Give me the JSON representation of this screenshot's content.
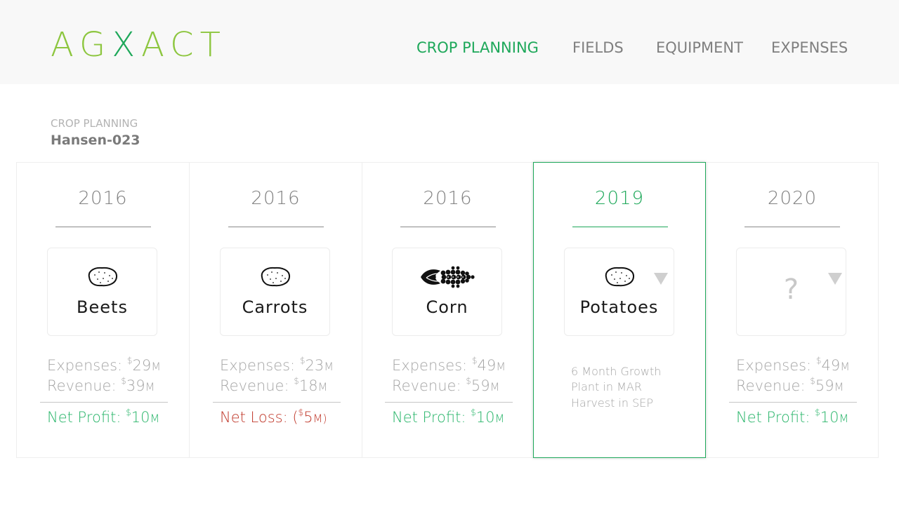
{
  "header": {
    "logo": {
      "part1": "AG",
      "part2": "X",
      "part3": "ACT"
    },
    "nav": [
      {
        "label": "CROP PLANNING",
        "active": true
      },
      {
        "label": "FIELDS",
        "active": false
      },
      {
        "label": "EQUIPMENT",
        "active": false
      },
      {
        "label": "EXPENSES",
        "active": false
      }
    ]
  },
  "page": {
    "breadcrumb": "CROP PLANNING",
    "plan_name": "Hansen-023"
  },
  "columns": [
    {
      "year": "2016",
      "crop": "Beets",
      "icon": "potato-icon",
      "expenses_label": "Expenses: ",
      "expenses_currency": "$",
      "expenses_value": "29",
      "expenses_unit": "M",
      "revenue_label": "Revenue: ",
      "revenue_currency": "$",
      "revenue_value": "39",
      "revenue_unit": "M",
      "net_label": "Net Profit: ",
      "net_currency": "$",
      "net_value": "10",
      "net_unit": "M"
    },
    {
      "year": "2016",
      "crop": "Carrots",
      "icon": "potato-icon",
      "expenses_label": "Expenses: ",
      "expenses_currency": "$",
      "expenses_value": "23",
      "expenses_unit": "M",
      "revenue_label": "Revenue: ",
      "revenue_currency": "$",
      "revenue_value": "18",
      "revenue_unit": "M",
      "net_label": "Net Loss: (",
      "net_currency": "$",
      "net_value": "5",
      "net_unit": "M)"
    },
    {
      "year": "2016",
      "crop": "Corn",
      "icon": "corn-icon",
      "expenses_label": "Expenses: ",
      "expenses_currency": "$",
      "expenses_value": "49",
      "expenses_unit": "M",
      "revenue_label": "Revenue: ",
      "revenue_currency": "$",
      "revenue_value": "59",
      "revenue_unit": "M",
      "net_label": "Net Profit: ",
      "net_currency": "$",
      "net_value": "10",
      "net_unit": "M"
    },
    {
      "year": "2019",
      "crop": "Potatoes",
      "icon": "potato-icon",
      "info": [
        "6 Month Growth",
        "Plant in MAR",
        "Harvest in SEP"
      ]
    },
    {
      "year": "2020",
      "crop": "?",
      "expenses_label": "Expenses: ",
      "expenses_currency": "$",
      "expenses_value": "49",
      "expenses_unit": "M",
      "revenue_label": "Revenue: ",
      "revenue_currency": "$",
      "revenue_value": "59",
      "revenue_unit": "M",
      "net_label": "Net Profit: ",
      "net_currency": "$",
      "net_value": "10",
      "net_unit": "M"
    }
  ],
  "colors": {
    "brand_light": "#8dc63f",
    "brand": "#1ea85a",
    "profit": "#29b56a",
    "loss": "#c0392b"
  }
}
